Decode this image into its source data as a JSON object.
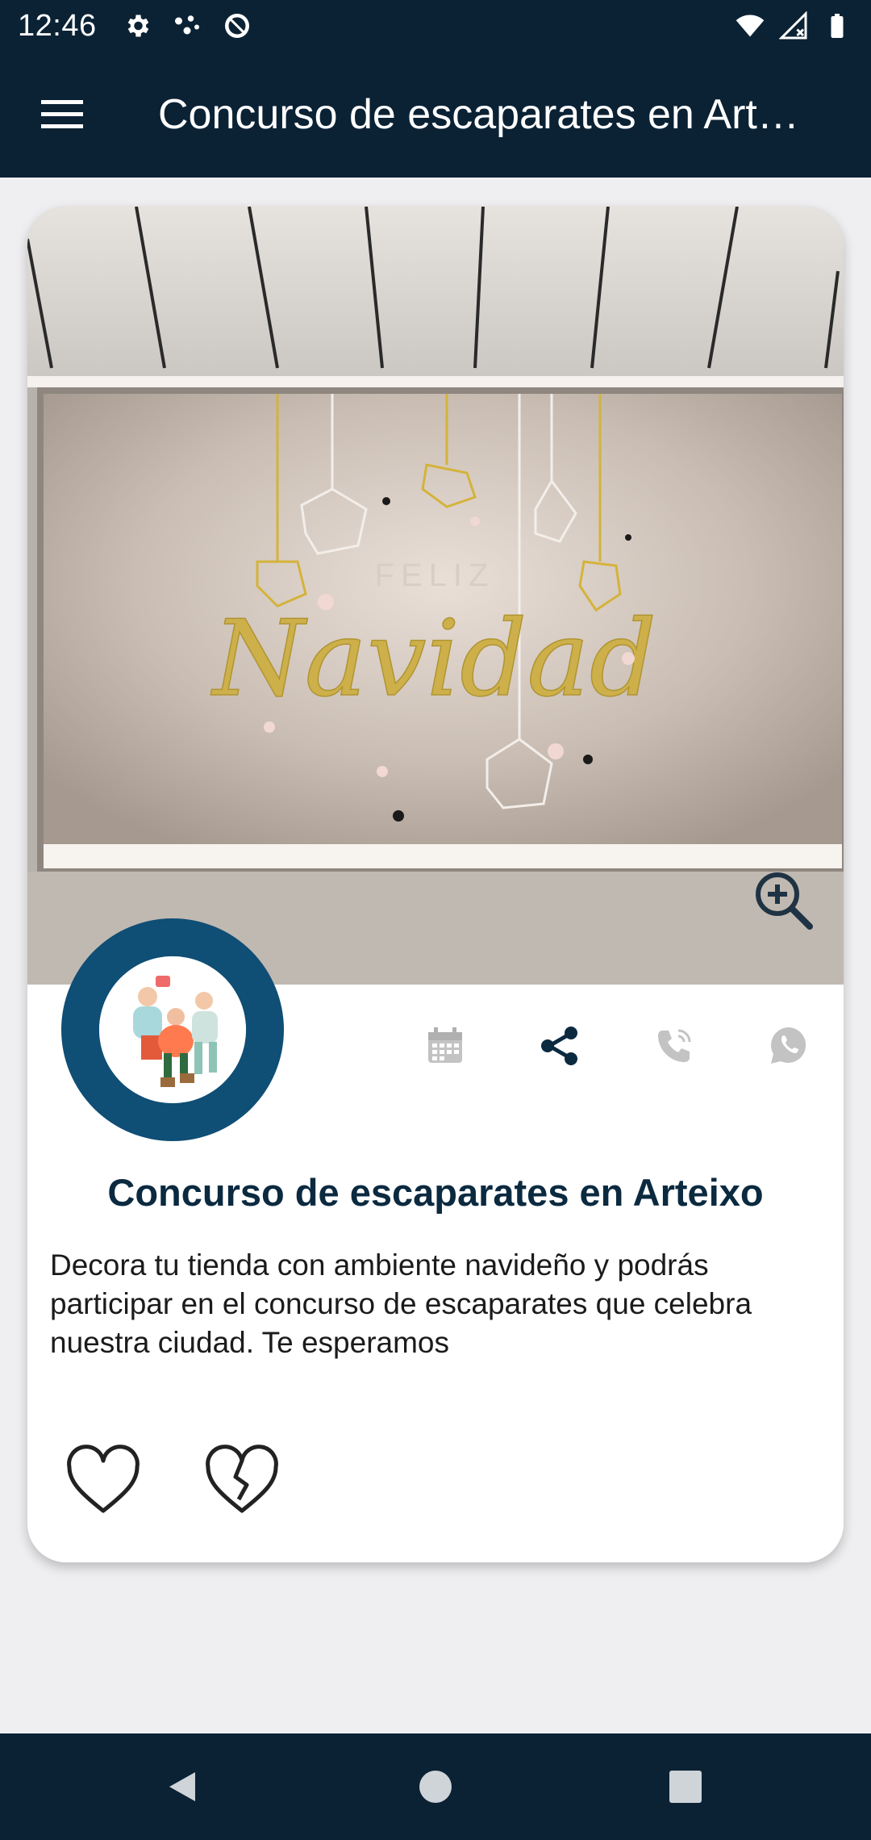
{
  "status_bar": {
    "time": "12:46",
    "left_icons": [
      "gear-icon",
      "dots-icon",
      "data-saver-icon"
    ],
    "right_icons": [
      "wifi-icon",
      "signal-icon",
      "battery-icon"
    ]
  },
  "app_bar": {
    "menu_icon": "hamburger-menu-icon",
    "title": "Concurso de escaparates en Arteixo"
  },
  "card": {
    "image_text": {
      "line1": "FELIZ",
      "line2": "Navidad"
    },
    "zoom_icon": "zoom-in-icon",
    "actions": [
      {
        "name": "calendar",
        "icon": "calendar-icon",
        "enabled": false
      },
      {
        "name": "share",
        "icon": "share-icon",
        "enabled": true
      },
      {
        "name": "phone",
        "icon": "phone-icon",
        "enabled": false
      },
      {
        "name": "whatsapp",
        "icon": "whatsapp-icon",
        "enabled": false
      }
    ],
    "title": "Concurso de escaparates en Arteixo",
    "description": "Decora tu tienda con ambiente navideño y podrás participar en el concurso de escaparates que celebra nuestra ciudad. Te esperamos",
    "reactions": [
      "like-heart-icon",
      "dislike-broken-heart-icon"
    ]
  },
  "nav_bar": {
    "buttons": [
      "back-icon",
      "home-icon",
      "recents-icon"
    ]
  },
  "colors": {
    "app_bar": "#0b2235",
    "accent_dark": "#0b2a40",
    "avatar_ring": "#0f4e75",
    "inactive_icon": "#b9b9b9",
    "background": "#efeef0"
  }
}
